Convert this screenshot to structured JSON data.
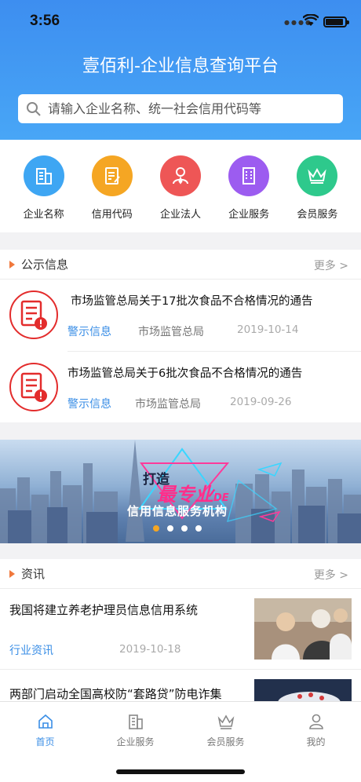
{
  "status_bar": {
    "time": "3:56"
  },
  "header": {
    "title": "壹佰利-企业信息查询平台"
  },
  "search": {
    "placeholder": "请输入企业名称、统一社会信用代码等"
  },
  "quick_menu": [
    {
      "label": "企业名称",
      "icon": "building-icon",
      "color": "#3ea6f3"
    },
    {
      "label": "信用代码",
      "icon": "document-edit-icon",
      "color": "#f5a623"
    },
    {
      "label": "企业法人",
      "icon": "person-icon",
      "color": "#ee5656"
    },
    {
      "label": "企业服务",
      "icon": "office-icon",
      "color": "#9c5cf0"
    },
    {
      "label": "会员服务",
      "icon": "crown-icon",
      "color": "#2ec98c"
    }
  ],
  "notices": {
    "title": "公示信息",
    "more": "更多",
    "items": [
      {
        "title": "市场监管总局关于17批次食品不合格情况的通告",
        "tag": "警示信息",
        "org": "市场监管总局",
        "date": "2019-10-14"
      },
      {
        "title": "市场监管总局关于6批次食品不合格情况的通告",
        "tag": "警示信息",
        "org": "市场监管总局",
        "date": "2019-09-26"
      }
    ]
  },
  "banner": {
    "line1": "打造",
    "line2": "最专业",
    "line2_suffix": "DE",
    "line3": "信用信息服务机构",
    "slide_count": 4,
    "active_slide": 1
  },
  "news": {
    "title": "资讯",
    "more": "更多",
    "items": [
      {
        "title": "我国将建立养老护理员信息信用系统",
        "tag": "行业资讯",
        "date": "2019-10-18"
      },
      {
        "title": "两部门启动全国高校防“套路贷”防电诈集",
        "tag": "",
        "date": ""
      }
    ]
  },
  "tabbar": [
    {
      "label": "首页",
      "icon": "home-icon",
      "active": true
    },
    {
      "label": "企业服务",
      "icon": "building-icon",
      "active": false
    },
    {
      "label": "会员服务",
      "icon": "crown-icon",
      "active": false
    },
    {
      "label": "我的",
      "icon": "user-icon",
      "active": false
    }
  ]
}
